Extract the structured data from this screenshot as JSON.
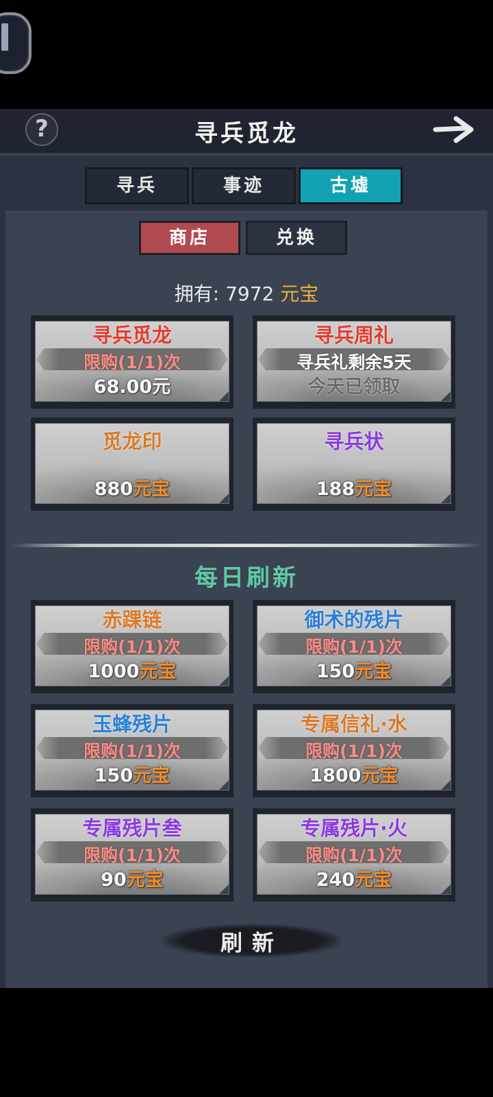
{
  "header": {
    "title": "寻兵觅龙",
    "help_icon": "question-icon",
    "forward_icon": "arrow-right-icon",
    "help_label": "?"
  },
  "tabs": [
    {
      "label": "寻兵",
      "active": false
    },
    {
      "label": "事迹",
      "active": false
    },
    {
      "label": "古墟",
      "active": true
    }
  ],
  "subtabs": [
    {
      "label": "商店",
      "active": true
    },
    {
      "label": "兑换",
      "active": false
    }
  ],
  "balance": {
    "prefix": "拥有:",
    "amount": "7972",
    "currency": "元宝"
  },
  "shop_items": [
    {
      "name": "寻兵觅龙",
      "limit": "限购(1/1)次",
      "price": "68.00元",
      "price_currency": ""
    },
    {
      "name": "寻兵周礼",
      "limit": "寻兵礼剩余5天",
      "price": "今天已领取",
      "price_currency": ""
    },
    {
      "name": "觅龙印",
      "price": "880",
      "price_currency": "元宝"
    },
    {
      "name": "寻兵状",
      "price": "188",
      "price_currency": "元宝"
    }
  ],
  "daily": {
    "title": "每日刷新",
    "items": [
      {
        "name": "赤踝链",
        "limit": "限购(1/1)次",
        "price": "1000",
        "price_currency": "元宝"
      },
      {
        "name": "御术的残片",
        "limit": "限购(1/1)次",
        "price": "150",
        "price_currency": "元宝"
      },
      {
        "name": "玉蜂残片",
        "limit": "限购(1/1)次",
        "price": "150",
        "price_currency": "元宝"
      },
      {
        "name": "专属信礼·水",
        "limit": "限购(1/1)次",
        "price": "1800",
        "price_currency": "元宝"
      },
      {
        "name": "专属残片叁",
        "limit": "限购(1/1)次",
        "price": "90",
        "price_currency": "元宝"
      },
      {
        "name": "专属残片·火",
        "limit": "限购(1/1)次",
        "price": "240",
        "price_currency": "元宝"
      }
    ]
  },
  "refresh_button": {
    "label": "刷新"
  },
  "colors": {
    "accent_tab": "#13a2b1",
    "active_subtab": "#b14a4e",
    "currency": "#e8b03c",
    "daily_title": "#5fcaa5"
  }
}
